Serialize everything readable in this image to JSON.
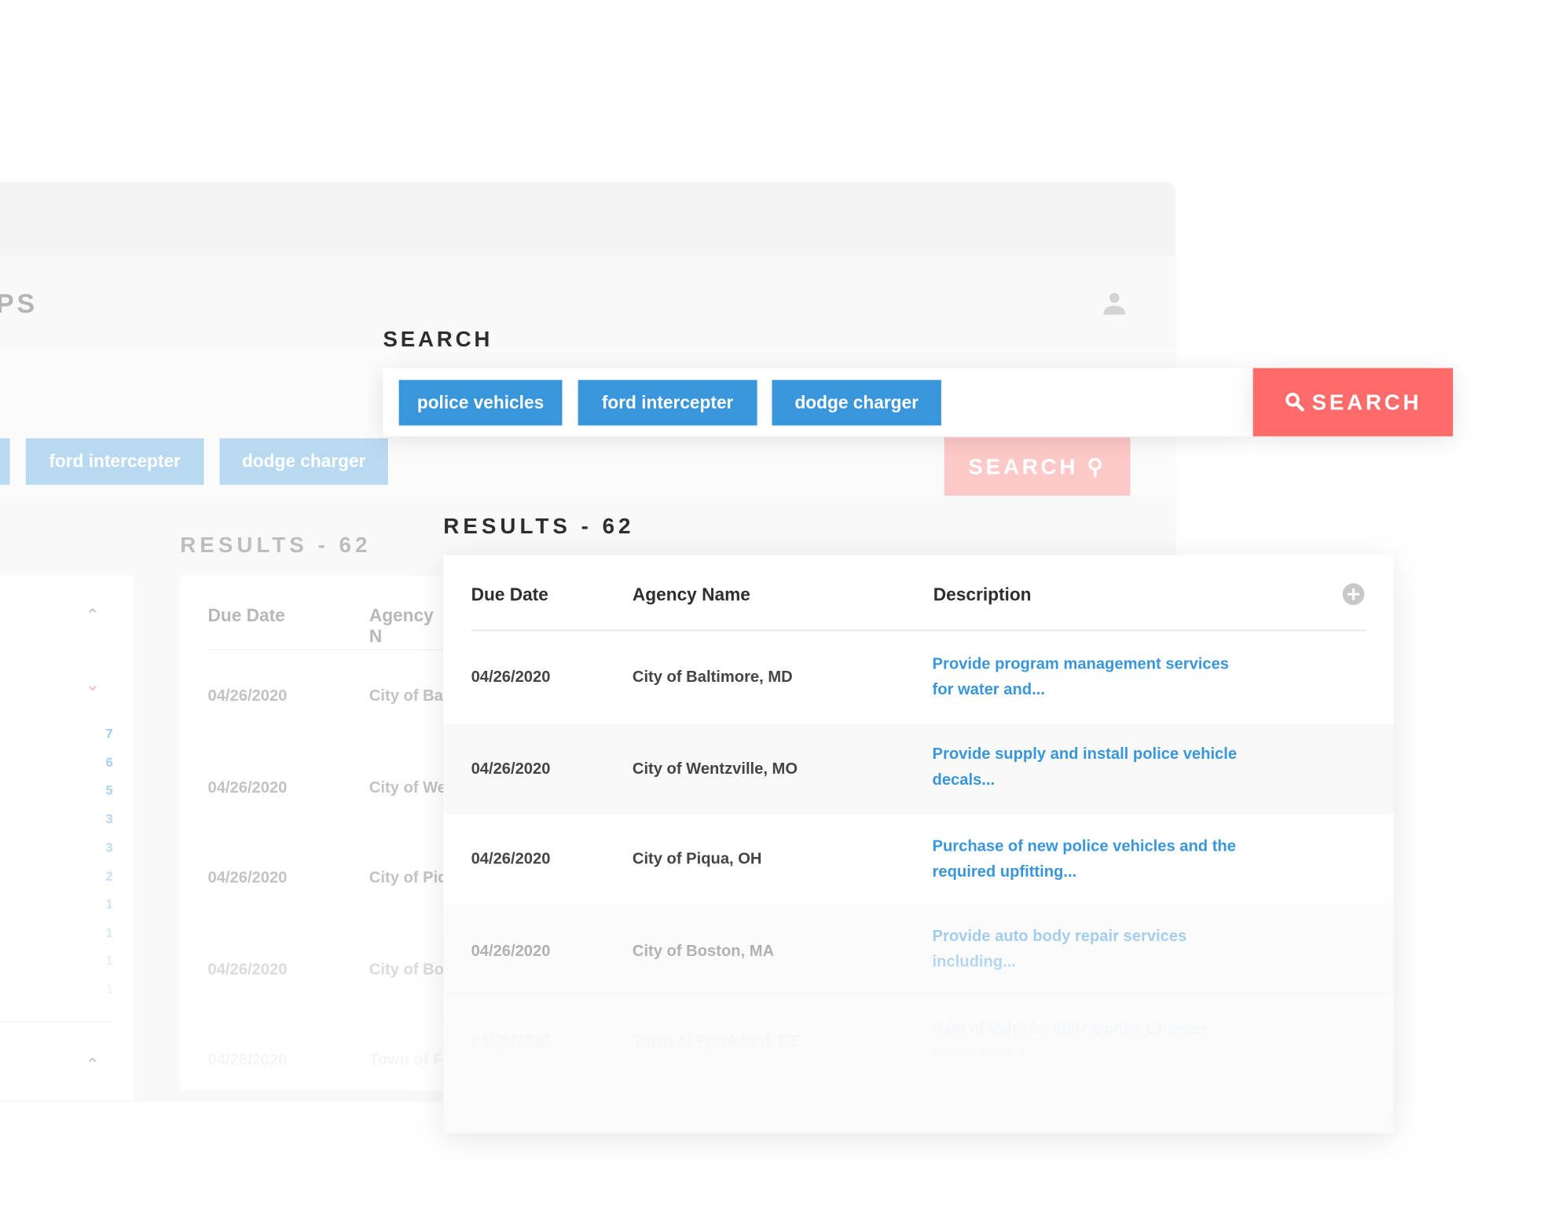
{
  "background_app": {
    "title_fragment": "PS",
    "chips": [
      "ford intercepter",
      "dodge charger"
    ],
    "search_label": "SEARCH",
    "results_label": "RESULTS - 62",
    "filter_counts": [
      "7",
      "6",
      "5",
      "3",
      "3",
      "2",
      "1",
      "1",
      "1",
      "1"
    ],
    "table": {
      "headers": [
        "Due Date",
        "Agency N"
      ],
      "rows": [
        {
          "date": "04/26/2020",
          "agency": "City of Bal"
        },
        {
          "date": "04/26/2020",
          "agency": "City of We"
        },
        {
          "date": "04/26/2020",
          "agency": "City of Piq"
        },
        {
          "date": "04/26/2020",
          "agency": "City of Bo"
        },
        {
          "date": "04/26/2020",
          "agency": "Town of F"
        }
      ]
    }
  },
  "search": {
    "heading": "SEARCH",
    "chips": [
      "police vehicles",
      "ford intercepter",
      "dodge charger"
    ],
    "button_label": "SEARCH",
    "icon": "search-icon"
  },
  "results": {
    "heading": "RESULTS - 62",
    "headers": [
      "Due Date",
      "Agency Name",
      "Description"
    ],
    "rows": [
      {
        "date": "04/26/2020",
        "agency": "City of Baltimore, MD",
        "description": "Provide program management services for water and..."
      },
      {
        "date": "04/26/2020",
        "agency": "City of Wentzville, MO",
        "description": "Provide supply and install police vehicle decals..."
      },
      {
        "date": "04/26/2020",
        "agency": "City of Piqua, OH",
        "description": "Purchase of new police vehicles and the required upfitting..."
      },
      {
        "date": "04/26/2020",
        "agency": "City of Boston, MA",
        "description": "Provide auto body repair services including..."
      },
      {
        "date": "04/26/2020",
        "agency": "Town of Frankford, DE",
        "description": "Sale of Vehicle: 2007 Dodge Charger, Color: Black..."
      }
    ]
  },
  "colors": {
    "chip": "#3a96da",
    "search_button": "#ff6b6b",
    "link": "#3a96da"
  }
}
